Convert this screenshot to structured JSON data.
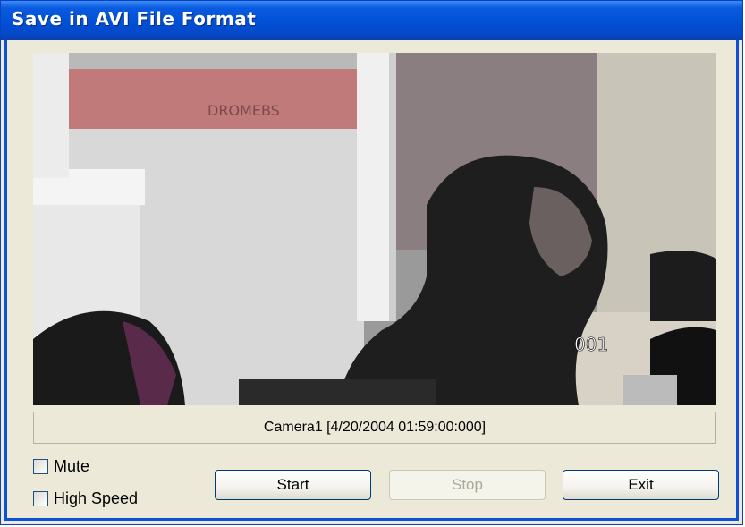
{
  "window": {
    "title": "Save in AVI File Format"
  },
  "video": {
    "overlay_number": "001",
    "wall_sign_text": "DROMEBS"
  },
  "caption": {
    "text": "Camera1 [4/20/2004  01:59:00:000]"
  },
  "options": {
    "mute": {
      "label": "Mute",
      "checked": false
    },
    "high_speed": {
      "label": "High Speed",
      "checked": false
    }
  },
  "buttons": {
    "start": {
      "label": "Start",
      "enabled": true
    },
    "stop": {
      "label": "Stop",
      "enabled": false
    },
    "exit": {
      "label": "Exit",
      "enabled": true
    }
  },
  "colors": {
    "titlebar": "#0150d6",
    "dialog_bg": "#ece9d8",
    "disabled_text": "#aca899"
  }
}
